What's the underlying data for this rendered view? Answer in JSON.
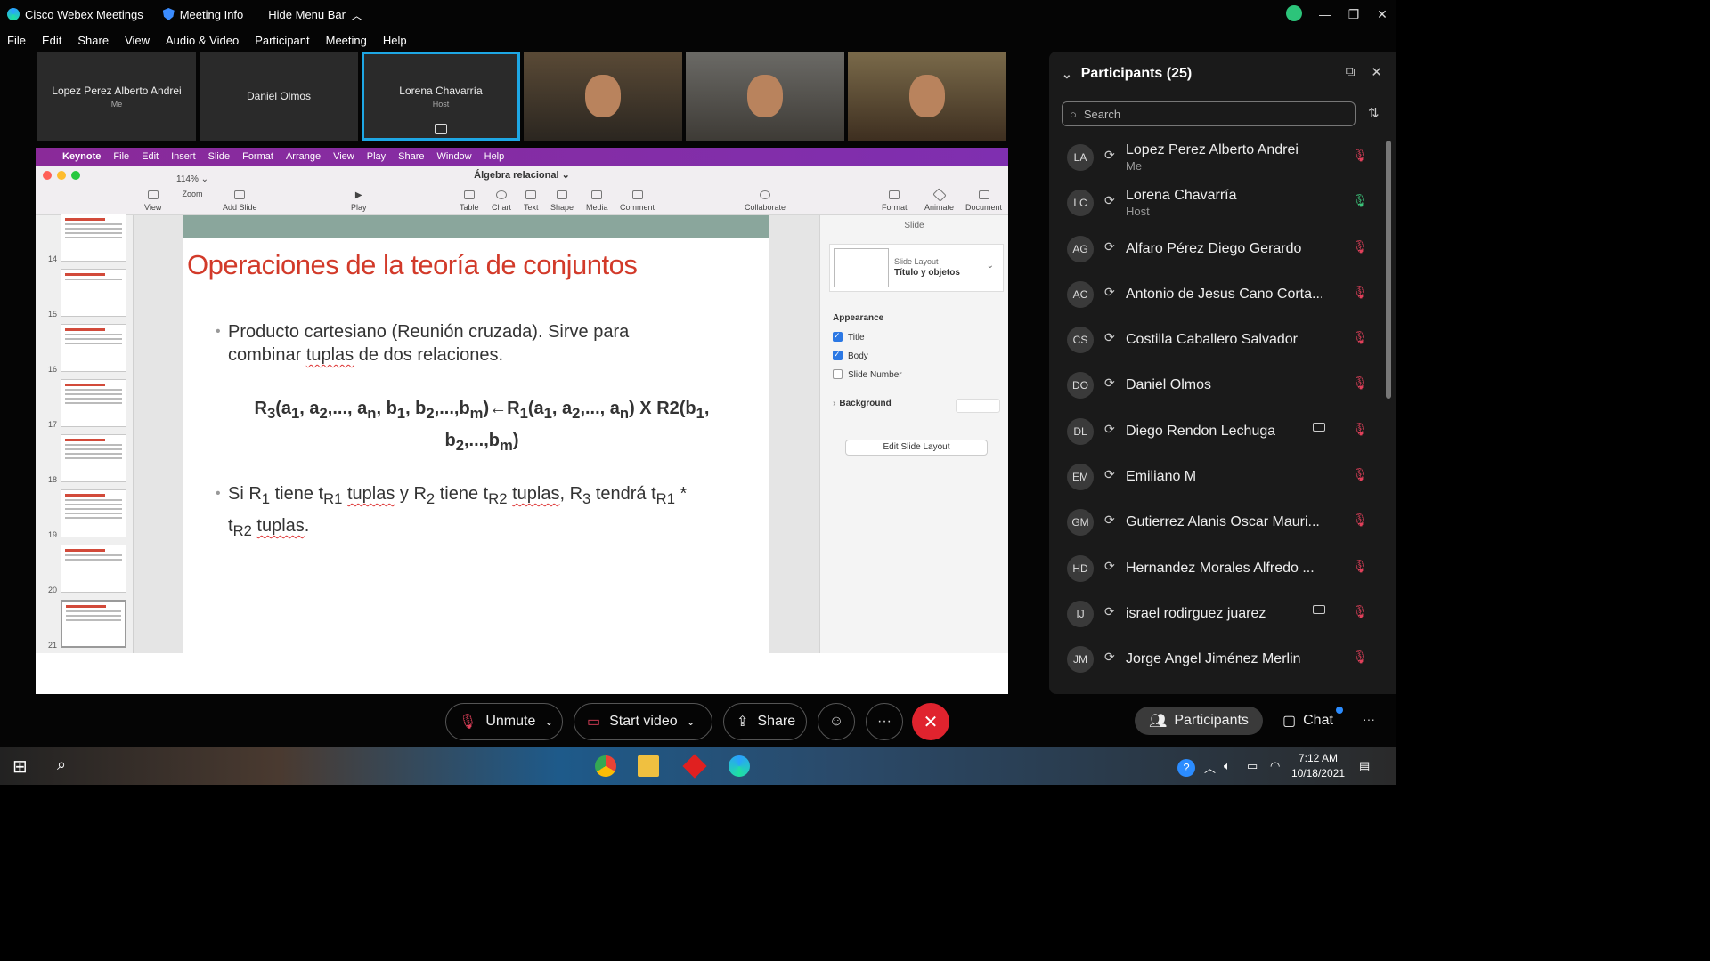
{
  "titlebar": {
    "app_name": "Cisco Webex Meetings",
    "meeting_info": "Meeting Info",
    "hide_menu": "Hide Menu Bar"
  },
  "menu": [
    "File",
    "Edit",
    "Share",
    "View",
    "Audio & Video",
    "Participant",
    "Meeting",
    "Help"
  ],
  "video_strip": [
    {
      "name": "Lopez Perez Alberto Andrei",
      "sub": "Me"
    },
    {
      "name": "Daniel Olmos",
      "sub": ""
    },
    {
      "name": "Lorena Chavarría",
      "sub": "Host"
    }
  ],
  "keynote": {
    "menu": [
      "Keynote",
      "File",
      "Edit",
      "Insert",
      "Slide",
      "Format",
      "Arrange",
      "View",
      "Play",
      "Share",
      "Window",
      "Help"
    ],
    "doc_title": "Álgebra relacional",
    "zoom": "114%",
    "toolbar": [
      "View",
      "Zoom",
      "Add Slide",
      "Play",
      "Table",
      "Chart",
      "Text",
      "Shape",
      "Media",
      "Comment",
      "Collaborate",
      "Format",
      "Animate",
      "Document"
    ],
    "thumb_numbers": [
      "14",
      "15",
      "16",
      "17",
      "18",
      "19",
      "20",
      "21"
    ],
    "slide": {
      "title": "Operaciones de la teoría de conjuntos",
      "bullet1_a": "Producto cartesiano (Reunión cruzada). Sirve para",
      "bullet1_b_pre": "combinar ",
      "bullet1_b_word": "tuplas",
      "bullet1_b_post": " de dos relaciones."
    },
    "inspector": {
      "header": "Slide",
      "layout_label": "Slide Layout",
      "layout_value": "Título y objetos",
      "appearance": "Appearance",
      "title_cb": "Title",
      "body_cb": "Body",
      "slide_number_cb": "Slide Number",
      "background": "Background",
      "edit_layout": "Edit Slide Layout"
    }
  },
  "participants": {
    "header": "Participants (25)",
    "search_placeholder": "Search",
    "list": [
      {
        "initials": "LA",
        "name": "Lopez Perez Alberto Andrei",
        "role": "Me",
        "mic": "muted",
        "video": false
      },
      {
        "initials": "LC",
        "name": "Lorena Chavarría",
        "role": "Host",
        "mic": "on",
        "video": false
      },
      {
        "initials": "AG",
        "name": "Alfaro Pérez Diego Gerardo",
        "role": "",
        "mic": "muted",
        "video": false
      },
      {
        "initials": "AC",
        "name": "Antonio de Jesus Cano Corta...",
        "role": "",
        "mic": "muted",
        "video": false
      },
      {
        "initials": "CS",
        "name": "Costilla Caballero Salvador",
        "role": "",
        "mic": "muted",
        "video": false
      },
      {
        "initials": "DO",
        "name": "Daniel Olmos",
        "role": "",
        "mic": "muted",
        "video": false
      },
      {
        "initials": "DL",
        "name": "Diego Rendon Lechuga",
        "role": "",
        "mic": "muted",
        "video": true
      },
      {
        "initials": "EM",
        "name": "Emiliano M",
        "role": "",
        "mic": "muted",
        "video": false
      },
      {
        "initials": "GM",
        "name": "Gutierrez Alanis Oscar Mauri...",
        "role": "",
        "mic": "muted",
        "video": false
      },
      {
        "initials": "HD",
        "name": "Hernandez Morales Alfredo ...",
        "role": "",
        "mic": "muted",
        "video": false
      },
      {
        "initials": "IJ",
        "name": "israel rodirguez juarez",
        "role": "",
        "mic": "muted",
        "video": true
      },
      {
        "initials": "JM",
        "name": "Jorge Angel Jiménez Merlin",
        "role": "",
        "mic": "muted",
        "video": false
      }
    ]
  },
  "controls": {
    "unmute": "Unmute",
    "start_video": "Start video",
    "share": "Share",
    "participants": "Participants",
    "chat": "Chat"
  },
  "taskbar": {
    "time": "7:12 AM",
    "date": "10/18/2021"
  }
}
